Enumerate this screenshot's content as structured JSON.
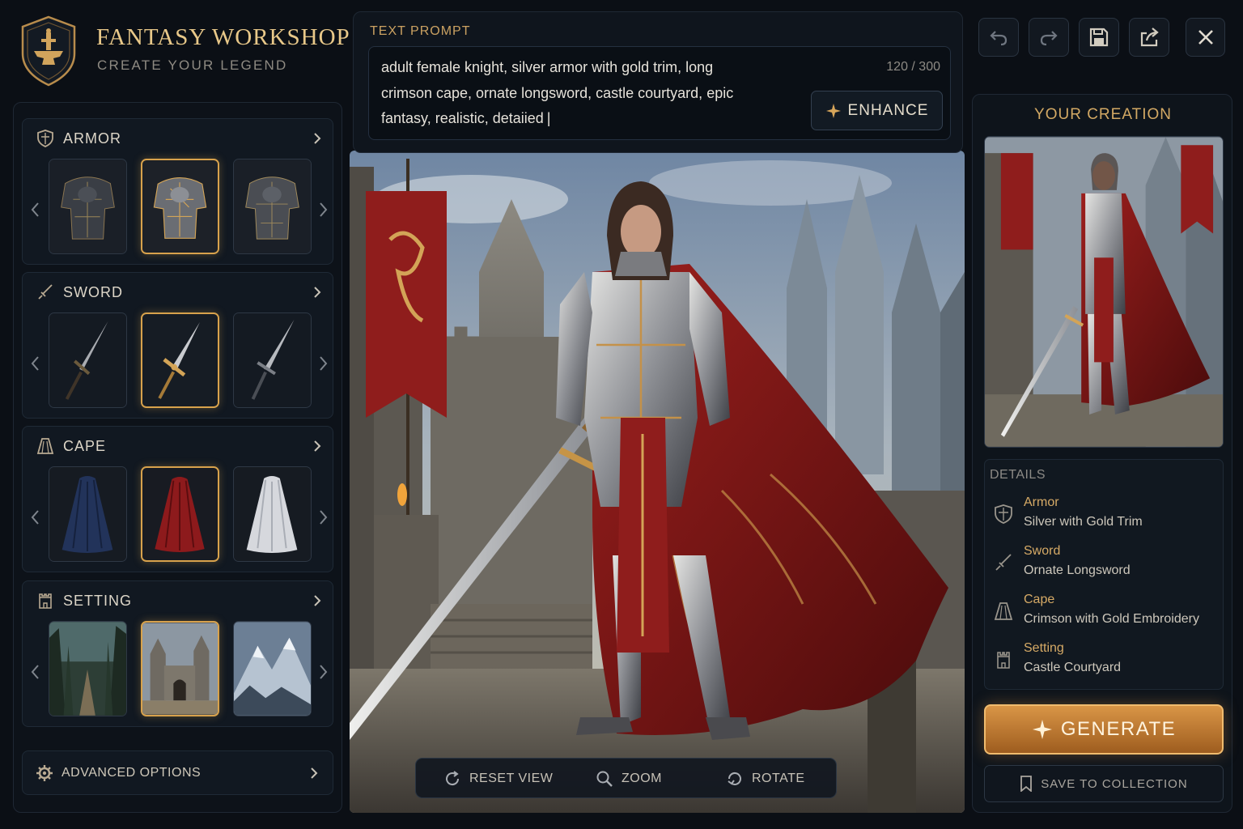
{
  "app": {
    "title": "FANTASY WORKSHOP",
    "subtitle": "CREATE YOUR LEGEND"
  },
  "colors": {
    "accent_gold": "#d8a24c",
    "background": "#0b0f15",
    "panel": "#111821",
    "generate_orange": "#d99546"
  },
  "categories": [
    {
      "label": "ARMOR",
      "icon": "shield-icon",
      "options": [
        "dark-armor",
        "silver-gold-armor",
        "engraved-armor"
      ],
      "selected_index": 1
    },
    {
      "label": "SWORD",
      "icon": "sword-icon",
      "options": [
        "plain-sword",
        "ornate-gold-sword",
        "steel-sword"
      ],
      "selected_index": 1
    },
    {
      "label": "CAPE",
      "icon": "cape-icon",
      "options": [
        "navy-cape",
        "crimson-cape",
        "white-cape"
      ],
      "selected_index": 1
    },
    {
      "label": "SETTING",
      "icon": "castle-tower-icon",
      "options": [
        "forest-path",
        "castle-courtyard",
        "snowy-peaks"
      ],
      "selected_index": 1
    }
  ],
  "advanced": {
    "label": "ADVANCED OPTIONS",
    "icon": "gear-icon"
  },
  "prompt": {
    "label": "TEXT PROMPT",
    "text": "adult female knight, silver armor with gold trim, long crimson cape, ornate longsword, castle courtyard, epic fantasy, realistic, detaiied",
    "count": "120 / 300",
    "enhance_label": "ENHANCE"
  },
  "view_tools": {
    "reset_label": "RESET VIEW",
    "zoom_label": "ZOOM",
    "rotate_label": "ROTATE"
  },
  "toolbar": {
    "buttons": [
      "undo-icon",
      "redo-icon",
      "save-icon",
      "share-icon",
      "close-icon"
    ]
  },
  "creation": {
    "title": "YOUR CREATION",
    "details_title": "DETAILS",
    "details": [
      {
        "name": "Armor",
        "value": "Silver with Gold Trim",
        "icon": "shield-icon"
      },
      {
        "name": "Sword",
        "value": "Ornate Longsword",
        "icon": "sword-icon"
      },
      {
        "name": "Cape",
        "value": "Crimson with Gold Embroidery",
        "icon": "cape-icon"
      },
      {
        "name": "Setting",
        "value": "Castle Courtyard",
        "icon": "castle-tower-icon"
      }
    ],
    "generate_label": "GENERATE",
    "save_label": "SAVE TO COLLECTION"
  }
}
